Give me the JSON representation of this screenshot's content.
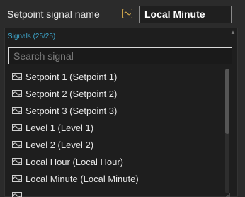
{
  "field": {
    "label": "Setpoint signal name",
    "value": "Local Minute"
  },
  "dropdown": {
    "header": "Signals (25/25)",
    "search_placeholder": "Search signal",
    "items": [
      {
        "label": "Setpoint 1 (Setpoint 1)"
      },
      {
        "label": "Setpoint 2 (Setpoint 2)"
      },
      {
        "label": "Setpoint 3 (Setpoint 3)"
      },
      {
        "label": "Level 1 (Level 1)"
      },
      {
        "label": "Level 2 (Level 2)"
      },
      {
        "label": "Local Hour (Local Hour)"
      },
      {
        "label": "Local Minute (Local Minute)"
      },
      {
        "label": ""
      }
    ]
  },
  "colors": {
    "accent": "#3fa9cf",
    "icon_border": "#c9a24a"
  }
}
